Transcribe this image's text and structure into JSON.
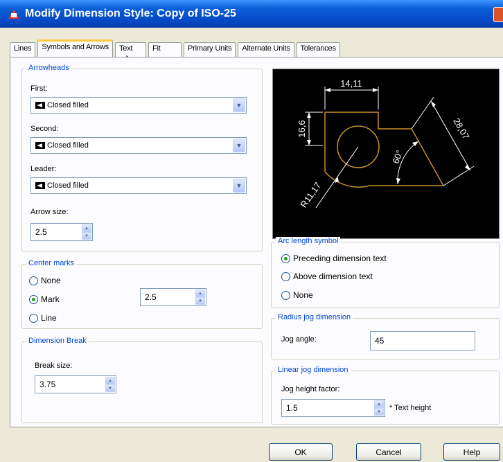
{
  "window": {
    "title": "Modify Dimension Style: Copy of ISO-25"
  },
  "tabs": [
    {
      "label": "Lines"
    },
    {
      "label": "Symbols and Arrows"
    },
    {
      "label": "Text"
    },
    {
      "label": "Fit"
    },
    {
      "label": "Primary Units"
    },
    {
      "label": "Alternate Units"
    },
    {
      "label": "Tolerances"
    }
  ],
  "arrowheads": {
    "legend": "Arrowheads",
    "first_label": "First:",
    "first_value": "Closed filled",
    "second_label": "Second:",
    "second_value": "Closed filled",
    "leader_label": "Leader:",
    "leader_value": "Closed filled",
    "arrow_size_label": "Arrow size:",
    "arrow_size_value": "2.5"
  },
  "center_marks": {
    "legend": "Center marks",
    "options": [
      "None",
      "Mark",
      "Line"
    ],
    "selected": "Mark",
    "size_value": "2.5"
  },
  "dimension_break": {
    "legend": "Dimension Break",
    "break_size_label": "Break size:",
    "break_size_value": "3.75"
  },
  "preview": {
    "dim_top": "14,11",
    "dim_left": "16,6",
    "dim_right": "28,07",
    "dim_angle": "60°",
    "dim_radius": "R11,17",
    "line_color": "#c8902a",
    "dim_color": "#ffffff"
  },
  "arc_length_symbol": {
    "legend": "Arc length symbol",
    "options": [
      "Preceding dimension text",
      "Above dimension text",
      "None"
    ],
    "selected": "Preceding dimension text"
  },
  "radius_jog": {
    "legend": "Radius jog dimension",
    "jog_angle_label": "Jog angle:",
    "jog_angle_value": "45"
  },
  "linear_jog": {
    "legend": "Linear jog dimension",
    "factor_label": "Jog height factor:",
    "factor_value": "1.5",
    "suffix": "* Text height"
  },
  "buttons": {
    "ok": "OK",
    "cancel": "Cancel",
    "help": "Help"
  }
}
